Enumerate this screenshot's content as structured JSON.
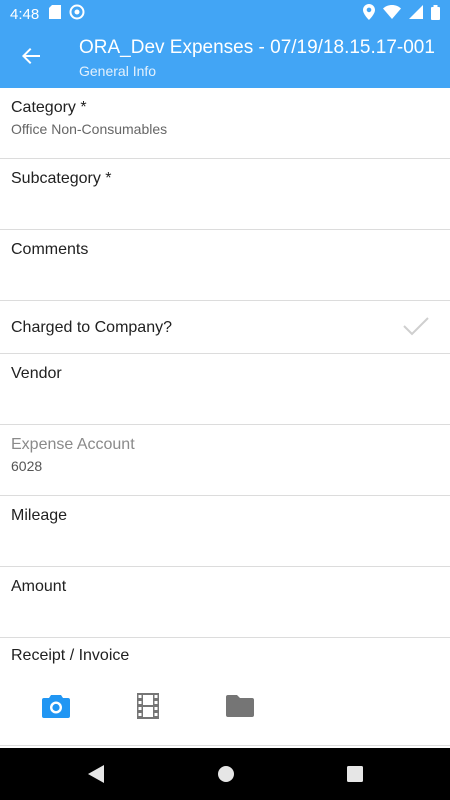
{
  "status_bar": {
    "time": "4:48"
  },
  "app_bar": {
    "title": "ORA_Dev Expenses - 07/19/18.15.17-001",
    "subtitle": "General Info"
  },
  "form": {
    "category": {
      "label": "Category *",
      "value": "Office Non-Consumables"
    },
    "subcategory": {
      "label": "Subcategory *",
      "value": ""
    },
    "comments": {
      "label": "Comments",
      "value": ""
    },
    "charged_to_company": {
      "label": "Charged to Company?",
      "checked": true
    },
    "vendor": {
      "label": "Vendor",
      "value": ""
    },
    "expense_account": {
      "label": "Expense Account",
      "value": "6028"
    },
    "mileage": {
      "label": "Mileage",
      "value": ""
    },
    "amount": {
      "label": "Amount",
      "value": ""
    },
    "receipt": {
      "label": "Receipt / Invoice"
    }
  },
  "icons": {
    "camera": "camera-icon",
    "video": "film-icon",
    "folder": "folder-icon"
  },
  "colors": {
    "accent": "#42a5f5",
    "camera_icon": "#2196f3",
    "inactive_icon": "#757575"
  }
}
